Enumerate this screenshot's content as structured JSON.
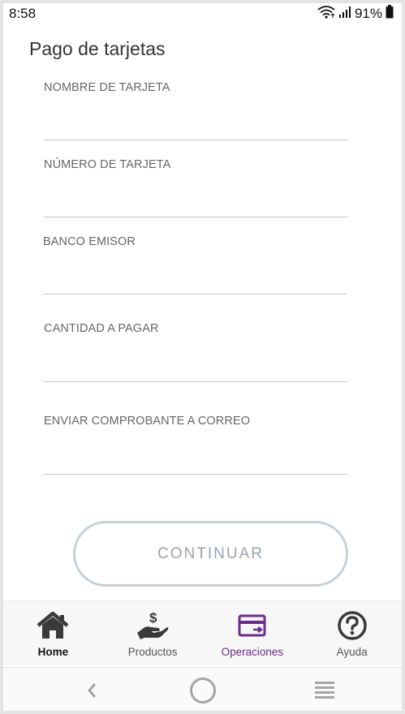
{
  "status_bar": {
    "time": "8:58",
    "battery_percent": "91%",
    "icons": [
      "wifi-icon",
      "signal-icon",
      "battery-icon"
    ]
  },
  "page": {
    "title": "Pago de tarjetas"
  },
  "form": {
    "fields": [
      {
        "label": "NOMBRE DE TARJETA",
        "value": ""
      },
      {
        "label": "NÚMERO DE TARJETA",
        "value": ""
      },
      {
        "label": "BANCO EMISOR",
        "value": ""
      },
      {
        "label": "CANTIDAD A PAGAR",
        "value": ""
      },
      {
        "label": "ENVIAR COMPROBANTE A CORREO",
        "value": ""
      }
    ],
    "continue_label": "CONTINUAR"
  },
  "bottom_nav": {
    "items": [
      {
        "label": "Home",
        "icon": "home-icon"
      },
      {
        "label": "Productos",
        "icon": "hand-money-icon"
      },
      {
        "label": "Operaciones",
        "icon": "card-transfer-icon"
      },
      {
        "label": "Ayuda",
        "icon": "help-icon"
      }
    ],
    "selected_color": "#6b2c8b"
  },
  "system_nav": {
    "icons": [
      "back-icon",
      "home-circle-icon",
      "recents-icon"
    ]
  }
}
